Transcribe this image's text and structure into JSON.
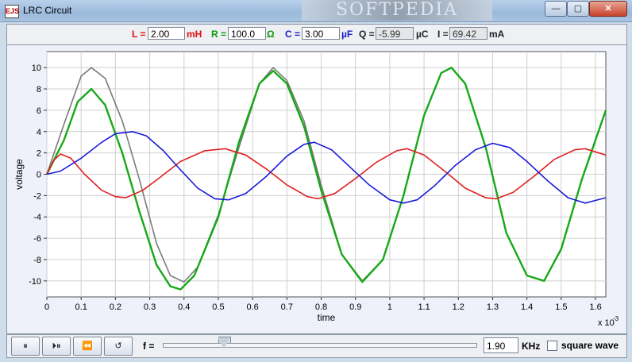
{
  "window": {
    "title": "LRC Circuit",
    "icon_text": "EJS",
    "watermark": "SOFTPEDIA",
    "buttons": {
      "minimize": "—",
      "maximize": "▢",
      "close": "✕"
    }
  },
  "params": {
    "L": {
      "label": "L =",
      "value": "2.00",
      "unit": "mH"
    },
    "R": {
      "label": "R =",
      "value": "100.0",
      "unit": "Ω"
    },
    "C": {
      "label": "C =",
      "value": "3.00",
      "unit": "µF"
    },
    "Q": {
      "label": "Q =",
      "value": "-5.99",
      "unit": "µC"
    },
    "I": {
      "label": "I =",
      "value": "69.42",
      "unit": "mA"
    },
    "colors": {
      "L": "#e01010",
      "R": "#0a9a0a",
      "C": "#1a1ad0",
      "Q": "#000000"
    }
  },
  "chart_data": {
    "type": "line",
    "xlabel": "time",
    "ylabel": "voltage",
    "x_scale_note": "x 10",
    "x_scale_exp": "-3",
    "xlim": [
      0,
      1.63
    ],
    "ylim": [
      -11.5,
      11.5
    ],
    "x_ticks": [
      0,
      0.1,
      0.2,
      0.3,
      0.4,
      0.5,
      0.6,
      0.7,
      0.8,
      0.9,
      1,
      1.1,
      1.2,
      1.3,
      1.4,
      1.5,
      1.6
    ],
    "x_tick_labels": [
      "0",
      "0.1",
      "0.2",
      "0.3",
      "0.4",
      "0.5",
      "0.6",
      "0.7",
      "0.8",
      "0.9",
      "1",
      "1.1",
      "1.2",
      "1.3",
      "1.4",
      "1.5",
      "1.6"
    ],
    "y_ticks": [
      -10,
      -8,
      -6,
      -4,
      -2,
      0,
      2,
      4,
      6,
      8,
      10
    ],
    "y_tick_labels": [
      "-10",
      "-8",
      "-6",
      "-4",
      "-2",
      "0",
      "2",
      "4",
      "6",
      "8",
      "10"
    ],
    "grid": true,
    "series": [
      {
        "color": "#7a7a7a",
        "points": [
          [
            0,
            0
          ],
          [
            0.05,
            4.7
          ],
          [
            0.1,
            9.2
          ],
          [
            0.13,
            10.0
          ],
          [
            0.17,
            9.0
          ],
          [
            0.22,
            5.0
          ],
          [
            0.27,
            -0.5
          ],
          [
            0.32,
            -6.5
          ],
          [
            0.36,
            -9.5
          ],
          [
            0.4,
            -10.1
          ],
          [
            0.44,
            -8.7
          ],
          [
            0.5,
            -3.8
          ],
          [
            0.56,
            2.5
          ],
          [
            0.62,
            8.5
          ],
          [
            0.66,
            10.0
          ],
          [
            0.7,
            8.8
          ],
          [
            0.75,
            5.0
          ],
          [
            0.8,
            -1.0
          ],
          [
            0.86,
            -7.5
          ],
          [
            0.92,
            -10.0
          ],
          [
            0.98,
            -8.0
          ],
          [
            1.04,
            -2.0
          ],
          [
            1.1,
            5.5
          ],
          [
            1.15,
            9.5
          ],
          [
            1.18,
            10.0
          ],
          [
            1.22,
            8.5
          ],
          [
            1.28,
            2.5
          ],
          [
            1.34,
            -5.5
          ],
          [
            1.4,
            -9.5
          ],
          [
            1.45,
            -10.0
          ],
          [
            1.5,
            -7.0
          ],
          [
            1.56,
            -0.5
          ],
          [
            1.63,
            6.0
          ]
        ]
      },
      {
        "color": "#18a818",
        "points": [
          [
            0,
            0
          ],
          [
            0.05,
            3.2
          ],
          [
            0.09,
            6.8
          ],
          [
            0.13,
            8.0
          ],
          [
            0.17,
            6.5
          ],
          [
            0.22,
            2.0
          ],
          [
            0.27,
            -3.5
          ],
          [
            0.32,
            -8.5
          ],
          [
            0.36,
            -10.5
          ],
          [
            0.39,
            -10.8
          ],
          [
            0.43,
            -9.5
          ],
          [
            0.5,
            -4.0
          ],
          [
            0.56,
            3.0
          ],
          [
            0.62,
            8.5
          ],
          [
            0.66,
            9.7
          ],
          [
            0.7,
            8.5
          ],
          [
            0.75,
            4.5
          ],
          [
            0.8,
            -1.5
          ],
          [
            0.86,
            -7.5
          ],
          [
            0.92,
            -10.1
          ],
          [
            0.98,
            -8.0
          ],
          [
            1.04,
            -2.0
          ],
          [
            1.1,
            5.5
          ],
          [
            1.15,
            9.5
          ],
          [
            1.18,
            10.0
          ],
          [
            1.22,
            8.5
          ],
          [
            1.28,
            2.5
          ],
          [
            1.34,
            -5.5
          ],
          [
            1.4,
            -9.5
          ],
          [
            1.45,
            -10.0
          ],
          [
            1.5,
            -7.0
          ],
          [
            1.56,
            -0.5
          ],
          [
            1.63,
            6.0
          ]
        ]
      },
      {
        "color": "#e02020",
        "points": [
          [
            0,
            0
          ],
          [
            0.02,
            1.3
          ],
          [
            0.04,
            1.9
          ],
          [
            0.07,
            1.5
          ],
          [
            0.11,
            0.0
          ],
          [
            0.16,
            -1.5
          ],
          [
            0.2,
            -2.1
          ],
          [
            0.23,
            -2.2
          ],
          [
            0.28,
            -1.5
          ],
          [
            0.33,
            -0.3
          ],
          [
            0.39,
            1.2
          ],
          [
            0.46,
            2.2
          ],
          [
            0.52,
            2.4
          ],
          [
            0.58,
            1.8
          ],
          [
            0.64,
            0.5
          ],
          [
            0.7,
            -1.0
          ],
          [
            0.76,
            -2.1
          ],
          [
            0.79,
            -2.3
          ],
          [
            0.84,
            -1.8
          ],
          [
            0.9,
            -0.4
          ],
          [
            0.96,
            1.1
          ],
          [
            1.02,
            2.2
          ],
          [
            1.05,
            2.4
          ],
          [
            1.1,
            1.8
          ],
          [
            1.16,
            0.3
          ],
          [
            1.22,
            -1.3
          ],
          [
            1.28,
            -2.2
          ],
          [
            1.31,
            -2.3
          ],
          [
            1.36,
            -1.7
          ],
          [
            1.42,
            -0.2
          ],
          [
            1.48,
            1.4
          ],
          [
            1.54,
            2.3
          ],
          [
            1.57,
            2.4
          ],
          [
            1.63,
            1.8
          ]
        ]
      },
      {
        "color": "#1a1ad8",
        "points": [
          [
            0,
            0
          ],
          [
            0.04,
            0.3
          ],
          [
            0.1,
            1.5
          ],
          [
            0.16,
            3.0
          ],
          [
            0.2,
            3.8
          ],
          [
            0.25,
            4.0
          ],
          [
            0.29,
            3.6
          ],
          [
            0.34,
            2.2
          ],
          [
            0.39,
            0.4
          ],
          [
            0.44,
            -1.3
          ],
          [
            0.49,
            -2.3
          ],
          [
            0.53,
            -2.4
          ],
          [
            0.58,
            -1.8
          ],
          [
            0.64,
            -0.2
          ],
          [
            0.7,
            1.7
          ],
          [
            0.75,
            2.8
          ],
          [
            0.78,
            3.0
          ],
          [
            0.83,
            2.3
          ],
          [
            0.88,
            0.8
          ],
          [
            0.94,
            -1.0
          ],
          [
            1.0,
            -2.4
          ],
          [
            1.04,
            -2.7
          ],
          [
            1.08,
            -2.4
          ],
          [
            1.13,
            -1.1
          ],
          [
            1.19,
            0.8
          ],
          [
            1.25,
            2.3
          ],
          [
            1.3,
            2.9
          ],
          [
            1.35,
            2.5
          ],
          [
            1.4,
            1.2
          ],
          [
            1.46,
            -0.6
          ],
          [
            1.52,
            -2.2
          ],
          [
            1.57,
            -2.7
          ],
          [
            1.63,
            -2.2
          ]
        ]
      }
    ]
  },
  "controls": {
    "pause": "⏸",
    "step": "⏵⏸",
    "rewind": "⏪",
    "reset": "↺",
    "f_label": "f =",
    "f_value": "1.90",
    "f_unit": "KHz",
    "f_slider_fraction": 0.22,
    "square_wave_label": "square wave",
    "square_wave_checked": false
  }
}
